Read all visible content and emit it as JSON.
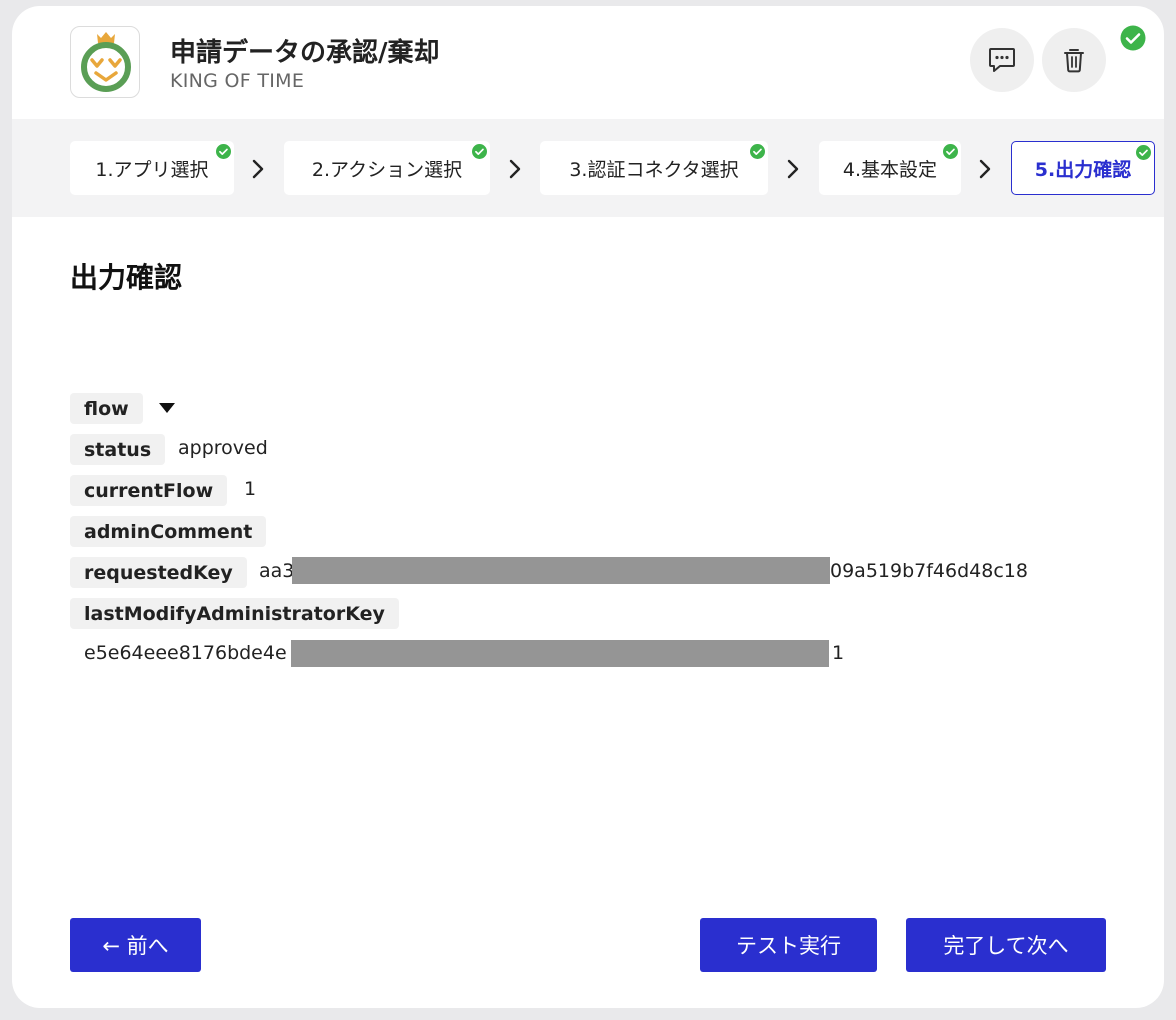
{
  "header": {
    "title": "申請データの承認/棄却",
    "subtitle": "KING OF TIME"
  },
  "steps": [
    {
      "label": "1.アプリ選択",
      "completed": true,
      "active": false
    },
    {
      "label": "2.アクション選択",
      "completed": true,
      "active": false
    },
    {
      "label": "3.認証コネクタ選択",
      "completed": true,
      "active": false
    },
    {
      "label": "4.基本設定",
      "completed": true,
      "active": false
    },
    {
      "label": "5.出力確認",
      "completed": true,
      "active": true
    }
  ],
  "section": {
    "title": "出力確認"
  },
  "output": {
    "flow": {
      "label": "flow"
    },
    "status": {
      "label": "status",
      "value": "approved"
    },
    "currentFlow": {
      "label": "currentFlow",
      "value": "1"
    },
    "adminComment": {
      "label": "adminComment",
      "value": ""
    },
    "requestedKey": {
      "label": "requestedKey",
      "value_start": "aa3",
      "value_end": "09a519b7f46d48c18"
    },
    "lastModifyAdministratorKey": {
      "label": "lastModifyAdministratorKey",
      "value_start": "e5e64eee8176bde4e",
      "value_end": "1"
    }
  },
  "footer": {
    "back_label": "← 前へ",
    "test_label": "テスト実行",
    "next_label": "完了して次へ"
  },
  "colors": {
    "primary": "#2a2fcf",
    "check": "#3db44a",
    "mask": "#959595"
  },
  "icons": {
    "comment": "comment-icon",
    "delete": "trash-icon",
    "check": "check-circle-icon",
    "separator": "chevron-right-icon",
    "expand": "caret-down-icon"
  }
}
